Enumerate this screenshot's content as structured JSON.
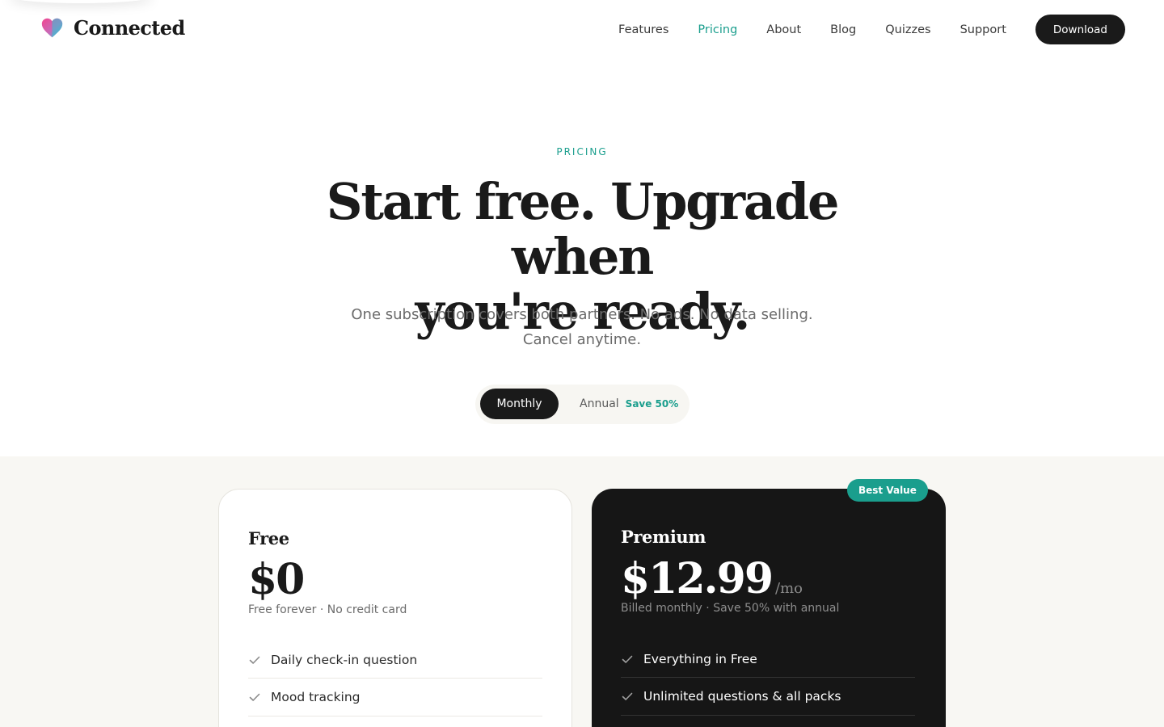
{
  "header": {
    "brand": "Connected",
    "brand_icon": "heart-gradient-icon",
    "nav": [
      {
        "label": "Features",
        "active": false
      },
      {
        "label": "Pricing",
        "active": true
      },
      {
        "label": "About",
        "active": false
      },
      {
        "label": "Blog",
        "active": false
      },
      {
        "label": "Quizzes",
        "active": false
      },
      {
        "label": "Support",
        "active": false
      }
    ],
    "download_label": "Download"
  },
  "hero": {
    "eyebrow": "PRICING",
    "title_line1": "Start free. Upgrade when",
    "title_line2": "you're ready.",
    "subtitle": "One subscription covers both partners. No ads. No data selling. Cancel anytime."
  },
  "billing_toggle": {
    "monthly_label": "Monthly",
    "annual_label": "Annual",
    "annual_badge": "Save 50%",
    "selected": "Monthly"
  },
  "plans": [
    {
      "name": "Free",
      "price": "$0",
      "unit": "",
      "note": "Free forever · No credit card",
      "features": [
        "Daily check-in question",
        "Mood tracking"
      ]
    },
    {
      "name": "Premium",
      "price": "$12.99",
      "unit": "/mo",
      "note": "Billed monthly · Save 50% with annual",
      "badge": "Best Value",
      "features": [
        "Everything in Free",
        "Unlimited questions & all packs"
      ]
    }
  ],
  "colors": {
    "accent": "#1a9e8d",
    "dark": "#161616",
    "band_background": "#f8f7f3",
    "logo_gradient_start": "#f2458f",
    "logo_gradient_end": "#2fc4d6"
  }
}
